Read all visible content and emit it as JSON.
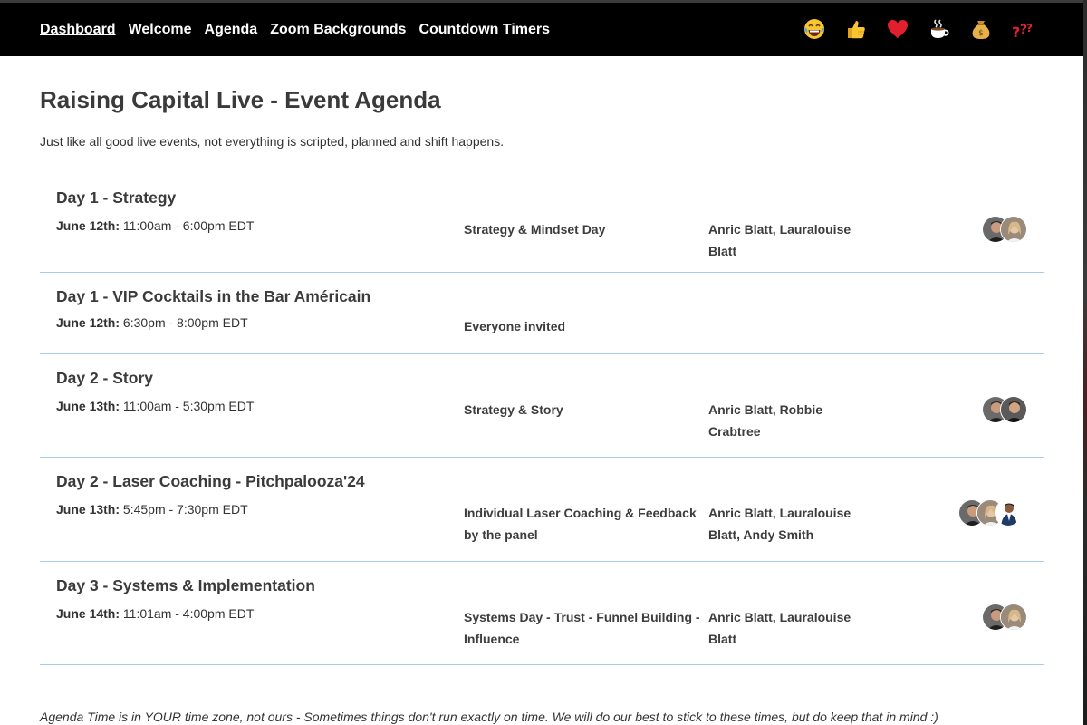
{
  "nav": {
    "items": [
      {
        "label": "Dashboard",
        "active": true
      },
      {
        "label": "Welcome"
      },
      {
        "label": "Agenda"
      },
      {
        "label": "Zoom Backgrounds"
      },
      {
        "label": "Countdown Timers"
      }
    ]
  },
  "reactions": [
    "laughing-face",
    "thumbs-up",
    "red-heart",
    "hot-beverage",
    "money-bag",
    "question-marks"
  ],
  "page": {
    "title": "Raising Capital Live - Event Agenda",
    "subtitle": "Just like all good live events, not everything is scripted, planned and shift happens."
  },
  "agenda": [
    {
      "title": "Day 1 - Strategy",
      "date": "June 12th:",
      "time": "11:00am - 6:00pm EDT",
      "description": "Strategy & Mindset Day",
      "speakers": "Anric Blatt, Lauralouise Blatt",
      "avatars": 2
    },
    {
      "title": "Day 1 - VIP Cocktails in the Bar Américain",
      "date": "June 12th:",
      "time": "6:30pm - 8:00pm EDT",
      "description": "Everyone invited",
      "speakers": "",
      "avatars": 0
    },
    {
      "title": "Day 2 - Story",
      "date": "June 13th:",
      "time": "11:00am - 5:30pm EDT",
      "description": "Strategy & Story",
      "speakers": "Anric Blatt, Robbie Crabtree",
      "avatars": 2
    },
    {
      "title": "Day 2 - Laser Coaching - Pitchpalooza'24",
      "date": "June 13th:",
      "time": "5:45pm - 7:30pm EDT",
      "description": "Individual Laser Coaching & Feedback by the panel",
      "speakers": "Anric Blatt, Lauralouise Blatt, Andy Smith",
      "avatars": 3
    },
    {
      "title": "Day 3 - Systems & Implementation",
      "date": "June 14th:",
      "time": "11:01am - 4:00pm EDT",
      "description": "Systems Day - Trust - Funnel Building - Influence",
      "speakers": "Anric Blatt, Lauralouise Blatt",
      "avatars": 2
    }
  ],
  "footer": "Agenda Time is in YOUR time zone, not ours - Sometimes things don't run exactly on time. We will do our best to stick to these times, but do keep that in mind :)"
}
